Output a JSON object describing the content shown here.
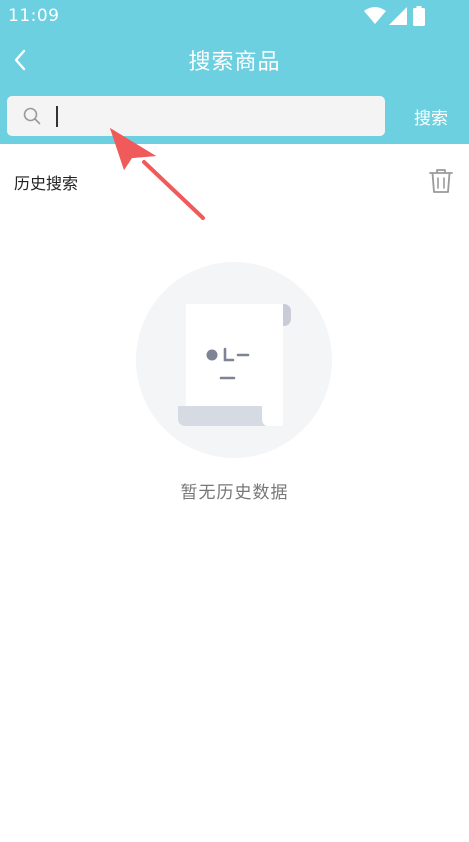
{
  "status_bar": {
    "time": "11:09",
    "icons": [
      "wifi-icon",
      "signal-icon",
      "battery-icon"
    ]
  },
  "nav": {
    "title": "搜索商品",
    "back_icon": "chevron-left-icon"
  },
  "search": {
    "placeholder": "",
    "value": "",
    "button_label": "搜索"
  },
  "history": {
    "title": "历史搜索",
    "clear_icon": "trash-icon"
  },
  "empty_state": {
    "text": "暂无历史数据",
    "illustration": "empty-document-icon"
  },
  "colors": {
    "header_bg": "#6cd0e0",
    "annotation_arrow": "#f05a5a"
  }
}
